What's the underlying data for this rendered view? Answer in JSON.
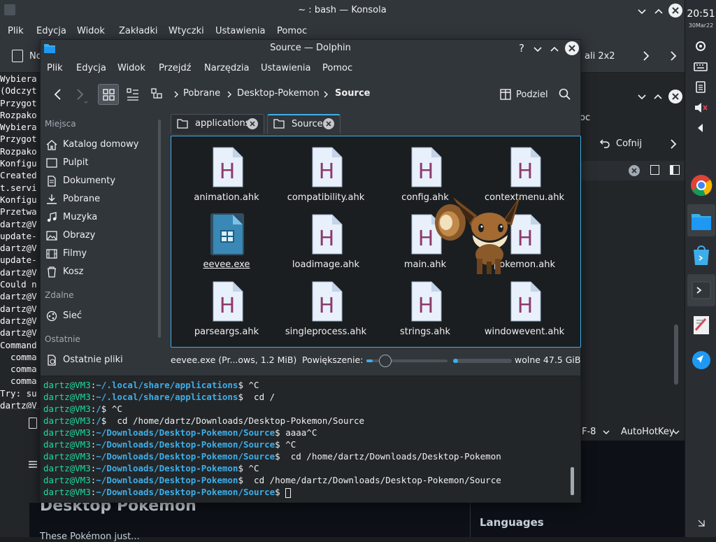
{
  "konsole": {
    "title": "~ : bash — Konsola",
    "menu": [
      "Plik",
      "Edycja",
      "Widok",
      "Zakładki",
      "Wtyczki",
      "Ustawienia",
      "Pomoc"
    ],
    "toolbar_new": "No",
    "split_label": "ali 2x2",
    "terminal_lines": [
      "Wybiera",
      "(Odczyt",
      "Przygot",
      "Rozpako",
      "Wybiera",
      "Przygot",
      "Rozpako",
      "Konfigu",
      "Created",
      "t.servi",
      "Konfigu",
      "Przetwa",
      "dartz@V",
      "update-",
      "dartz@V",
      "update-",
      "dartz@V",
      "Could n",
      "dartz@V",
      "dartz@V",
      "dartz@V",
      "dartz@V",
      "Command",
      "  comma",
      "  comma",
      "  comma",
      "Try: su",
      "dartz@V"
    ]
  },
  "browser": {
    "undo": "Cofnij",
    "fragment": "oc",
    "encoding": "F-8",
    "syntax": "AutoHotKey",
    "languages_heading": "Languages",
    "page_heading": "Desktop Pokemon",
    "page_text": "These Pokémon just..."
  },
  "dolphin": {
    "title": "Source — Dolphin",
    "menu": [
      "Plik",
      "Edycja",
      "Widok",
      "Przejdź",
      "Narzędzia",
      "Ustawienia",
      "Pomoc"
    ],
    "breadcrumb": [
      "Pobrane",
      "Desktop-Pokemon",
      "Source"
    ],
    "split_label": "Podziel",
    "places": {
      "heading_places": "Miejsca",
      "items": [
        "Katalog domowy",
        "Pulpit",
        "Dokumenty",
        "Pobrane",
        "Muzyka",
        "Obrazy",
        "Filmy",
        "Kosz"
      ],
      "heading_remote": "Zdalne",
      "remote_items": [
        "Sieć"
      ],
      "heading_recent": "Ostatnie",
      "recent_items": [
        "Ostatnie pliki"
      ]
    },
    "tabs": [
      "applications",
      "Source"
    ],
    "files": [
      "animation.ahk",
      "compatibility.ahk",
      "config.ahk",
      "contextmenu.ahk",
      "eevee.exe",
      "loadimage.ahk",
      "main.ahk",
      "pokemon.ahk",
      "parseargs.ahk",
      "singleprocess.ahk",
      "strings.ahk",
      "windowevent.ahk"
    ],
    "selected_file": "eevee.exe",
    "status": {
      "selection": "eevee.exe (Pr...ows, 1.2 MiB)",
      "zoom_label": "Powiększenie:",
      "zoom_level": 0.08,
      "free_space": "wolne 47.5 GiB",
      "disk_used": 0.08
    },
    "terminal": [
      {
        "user": "dartz@VM3",
        "path": "~/.local/share/applications",
        "cmd": " ^C"
      },
      {
        "user": "dartz@VM3",
        "path": "~/.local/share/applications",
        "cmd": "  cd /"
      },
      {
        "user": "dartz@VM3",
        "path": "/",
        "cmd": " ^C"
      },
      {
        "user": "dartz@VM3",
        "path": "/",
        "cmd": "  cd /home/dartz/Downloads/Desktop-Pokemon/Source"
      },
      {
        "user": "dartz@VM3",
        "path": "~/Downloads/Desktop-Pokemon/Source",
        "cmd": " aaaa^C"
      },
      {
        "user": "dartz@VM3",
        "path": "~/Downloads/Desktop-Pokemon/Source",
        "cmd": " ^C"
      },
      {
        "user": "dartz@VM3",
        "path": "~/Downloads/Desktop-Pokemon/Source",
        "cmd": "  cd /home/dartz/Downloads/Desktop-Pokemon"
      },
      {
        "user": "dartz@VM3",
        "path": "~/Downloads/Desktop-Pokemon",
        "cmd": " ^C"
      },
      {
        "user": "dartz@VM3",
        "path": "~/Downloads/Desktop-Pokemon",
        "cmd": "  cd /home/dartz/Downloads/Desktop-Pokemon/Source"
      },
      {
        "user": "dartz@VM3",
        "path": "~/Downloads/Desktop-Pokemon/Source",
        "cmd": " "
      }
    ]
  },
  "panel": {
    "time": "20:51",
    "date": "30Mar22"
  },
  "colors": {
    "accent": "#3daee9",
    "prompt_user": "#1cdc9a",
    "prompt_path": "#3daee9",
    "ahk_h": "#8b3b6d"
  }
}
